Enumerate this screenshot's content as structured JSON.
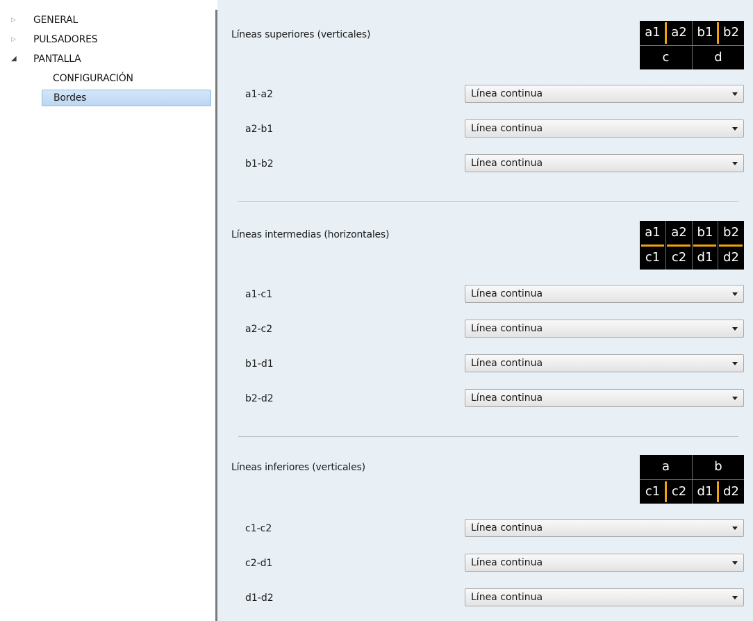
{
  "tree": {
    "items": [
      {
        "label": "GENERAL"
      },
      {
        "label": "PULSADORES"
      },
      {
        "label": "PANTALLA"
      },
      {
        "label": "CONFIGURACIÓN"
      },
      {
        "label": "Bordes"
      }
    ]
  },
  "sections": [
    {
      "title": "Líneas superiores (verticales)",
      "diagram": {
        "top": [
          "a1",
          "a2",
          "b1",
          "b2"
        ],
        "bottom": [
          "c",
          "d"
        ]
      },
      "rows": [
        {
          "label": "a1-a2",
          "value": "Línea continua"
        },
        {
          "label": "a2-b1",
          "value": "Línea continua"
        },
        {
          "label": "b1-b2",
          "value": "Línea continua"
        }
      ]
    },
    {
      "title": "Líneas intermedias (horizontales)",
      "diagram": {
        "top": [
          "a1",
          "a2",
          "b1",
          "b2"
        ],
        "bottom": [
          "c1",
          "c2",
          "d1",
          "d2"
        ]
      },
      "rows": [
        {
          "label": "a1-c1",
          "value": "Línea continua"
        },
        {
          "label": "a2-c2",
          "value": "Línea continua"
        },
        {
          "label": "b1-d1",
          "value": "Línea continua"
        },
        {
          "label": "b2-d2",
          "value": "Línea continua"
        }
      ]
    },
    {
      "title": "Líneas inferiores (verticales)",
      "diagram": {
        "top": [
          "a",
          "b"
        ],
        "bottom": [
          "c1",
          "c2",
          "d1",
          "d2"
        ]
      },
      "rows": [
        {
          "label": "c1-c2",
          "value": "Línea continua"
        },
        {
          "label": "c2-d1",
          "value": "Línea continua"
        },
        {
          "label": "d1-d2",
          "value": "Línea continua"
        }
      ]
    }
  ],
  "colors": {
    "accent_highlight": "#f2a20c",
    "selection": "#bcd7f3",
    "panel_bg": "#e8f0f6"
  },
  "icons": {
    "collapsed": "triangle-right-icon",
    "expanded": "triangle-down-icon",
    "dropdown": "caret-down-icon"
  }
}
